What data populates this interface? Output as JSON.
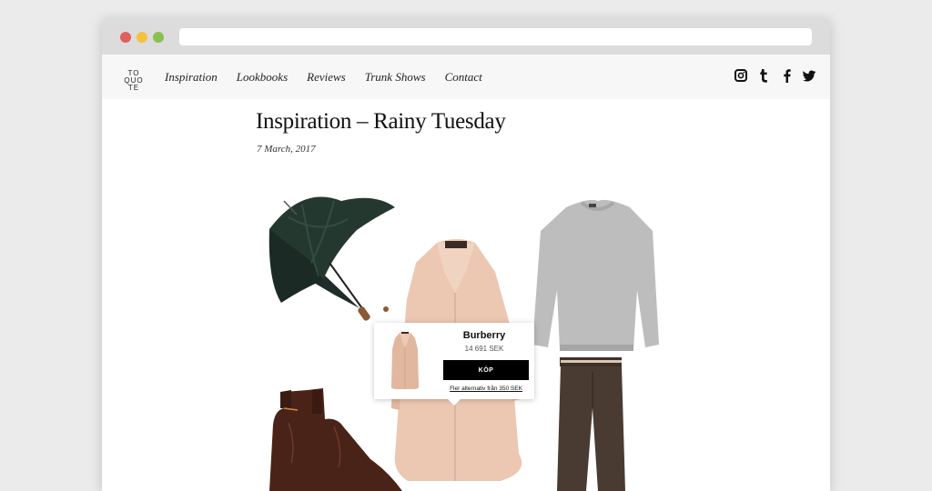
{
  "browser": {
    "url": ""
  },
  "site": {
    "logo": [
      "TO",
      "QUO",
      "TE"
    ],
    "nav": [
      "Inspiration",
      "Lookbooks",
      "Reviews",
      "Trunk Shows",
      "Contact"
    ],
    "social_icons": [
      "instagram-icon",
      "tumblr-icon",
      "facebook-icon",
      "twitter-icon"
    ]
  },
  "post": {
    "title": "Inspiration – Rainy Tuesday",
    "date": "7 March, 2017"
  },
  "products": [
    "umbrella",
    "trench-coat",
    "grey-sweater",
    "brown-trousers",
    "chelsea-boots"
  ],
  "popup": {
    "brand": "Burberry",
    "price": "14 691 SEK",
    "buy_label": "KÖP",
    "more_link": "Fler alternativ från 350 SEK"
  },
  "colors": {
    "background": "#ebebeb",
    "navbar": "#f7f7f7",
    "buy_button": "#000000",
    "coat": "#ecc7b2",
    "sweater": "#b9b9b9",
    "trousers": "#4a3b32",
    "boots": "#4a2318",
    "umbrella": "#243530"
  }
}
